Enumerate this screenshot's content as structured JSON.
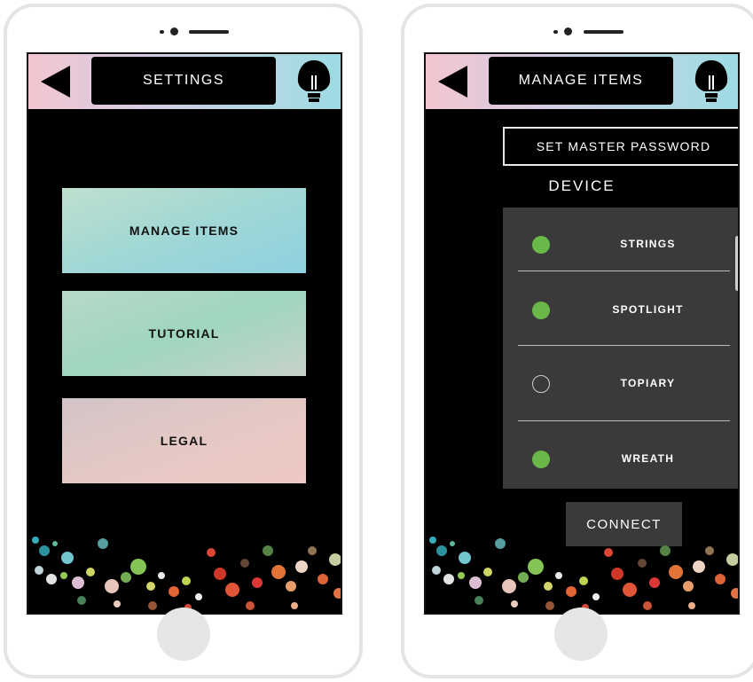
{
  "left_screen": {
    "title": "SETTINGS",
    "menu": [
      {
        "label": "MANAGE ITEMS"
      },
      {
        "label": "TUTORIAL"
      },
      {
        "label": "LEGAL"
      }
    ]
  },
  "right_screen": {
    "title": "MANAGE ITEMS",
    "set_password_label": "SET MASTER PASSWORD",
    "device_label": "DEVICE",
    "devices": [
      {
        "name": "STRINGS",
        "selected": true
      },
      {
        "name": "SPOTLIGHT",
        "selected": true
      },
      {
        "name": "TOPIARY",
        "selected": false
      },
      {
        "name": "WREATH",
        "selected": true
      }
    ],
    "connect_label": "CONNECT"
  },
  "colors": {
    "selected_radio": "#6ab74a",
    "panel_gray": "#3a3a3a"
  },
  "icons": {
    "back": "back-triangle-icon",
    "bulb": "light-bulb-icon"
  }
}
